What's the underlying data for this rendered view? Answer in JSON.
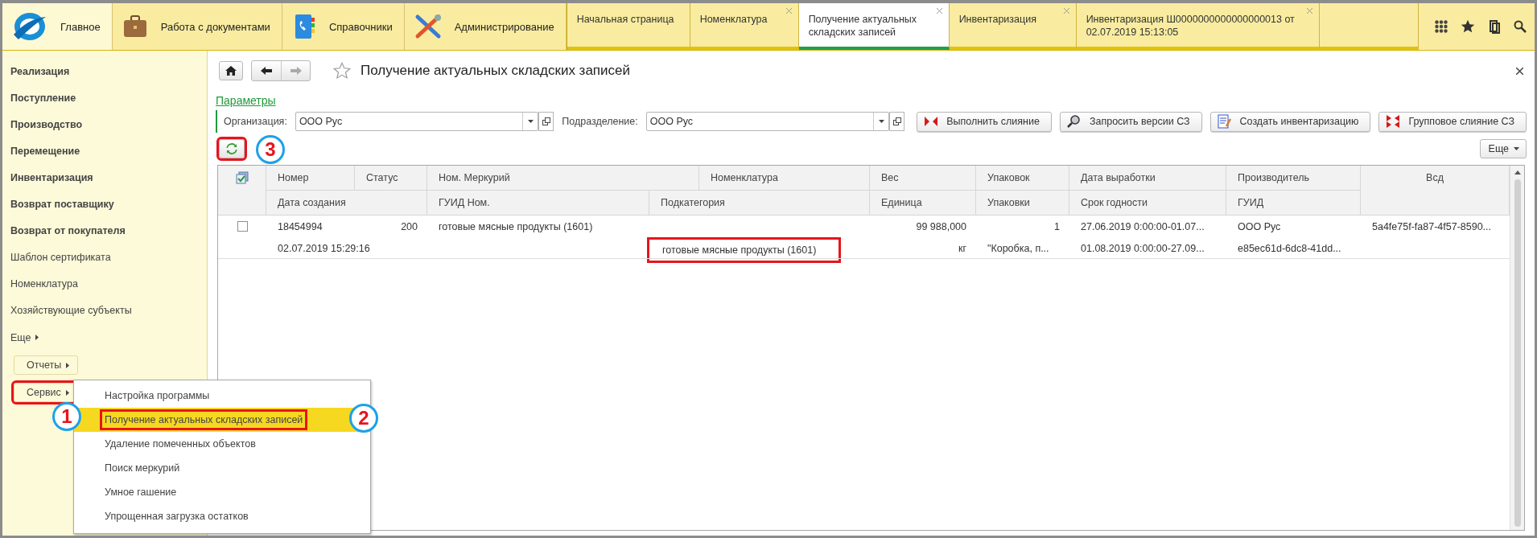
{
  "sections": [
    {
      "label": "Главное",
      "kind": "logo",
      "selected": true
    },
    {
      "label": "Работа с документами",
      "kind": "briefcase",
      "selected": false
    },
    {
      "label": "Справочники",
      "kind": "book",
      "selected": false
    },
    {
      "label": "Администрирование",
      "kind": "tools",
      "selected": false
    }
  ],
  "open_tabs": [
    {
      "label": "Начальная страница",
      "closable": false,
      "selected": false
    },
    {
      "label": "Номенклатура",
      "closable": true,
      "selected": false
    },
    {
      "label": "Получение актуальных складских записей",
      "closable": true,
      "selected": true
    },
    {
      "label": "Инвентаризация",
      "closable": true,
      "selected": false
    },
    {
      "label": "Инвентаризация Ш0000000000000000013 от 02.07.2019 15:13:05",
      "closable": true,
      "selected": false
    }
  ],
  "sidebar": {
    "items": [
      {
        "label": "Реализация",
        "bold": true
      },
      {
        "label": "Поступление",
        "bold": true
      },
      {
        "label": "Производство",
        "bold": true
      },
      {
        "label": "Перемещение",
        "bold": true
      },
      {
        "label": "Инвентаризация",
        "bold": true
      },
      {
        "label": "Возврат поставщику",
        "bold": true
      },
      {
        "label": "Возврат от покупателя",
        "bold": true
      },
      {
        "label": "Шаблон сертификата",
        "bold": false
      },
      {
        "label": "Номенклатура",
        "bold": false
      },
      {
        "label": "Хозяйствующие субъекты",
        "bold": false
      }
    ],
    "more": "Еще",
    "buttons": [
      {
        "label": "Отчеты",
        "highlighted": false
      },
      {
        "label": "Сервис",
        "highlighted": true,
        "callout": "1"
      }
    ]
  },
  "service_menu": [
    {
      "label": "Настройка программы",
      "selected": false,
      "highlighted": false
    },
    {
      "label": "Получение актуальных складских записей",
      "selected": true,
      "highlighted": true,
      "callout": "2"
    },
    {
      "label": "Удаление помеченных объектов",
      "selected": false,
      "highlighted": false
    },
    {
      "label": "Поиск меркурий",
      "selected": false,
      "highlighted": false
    },
    {
      "label": "Умное гашение",
      "selected": false,
      "highlighted": false
    },
    {
      "label": "Упрощенная загрузка остатков",
      "selected": false,
      "highlighted": false
    }
  ],
  "form": {
    "title": "Получение актуальных складских записей",
    "forward_disabled": true,
    "favorite": false,
    "parameters_link": "Параметры",
    "filters": [
      {
        "label": "Организация:",
        "value": "ООО Рус"
      },
      {
        "label": "Подразделение:",
        "value": "ООО Рус"
      }
    ],
    "actions": [
      {
        "label": "Выполнить слияние",
        "kind": "merge"
      },
      {
        "label": "Запросить версии СЗ",
        "kind": "query"
      },
      {
        "label": "Создать инвентаризацию",
        "kind": "inventory"
      },
      {
        "label": "Групповое слияние СЗ",
        "kind": "group"
      }
    ],
    "refresh": {
      "highlighted": true,
      "callout": "3"
    },
    "more_button": "Еще"
  },
  "table": {
    "header_top": [
      "Номер",
      "Статус",
      "Ном. Меркурий",
      "Номенклатура",
      "Вес",
      "Упаковок",
      "Дата выработки",
      "Производитель",
      "Всд"
    ],
    "header_bottom": [
      "Дата создания",
      "ГУИД Ном.",
      "Подкатегория",
      "Единица",
      "Упаковки",
      "Срок годности",
      "ГУИД"
    ],
    "rows": [
      {
        "checked": false,
        "line1": [
          {
            "text": "18454994",
            "highlighted": false
          },
          {
            "text": "200",
            "highlighted": false
          },
          {
            "text": "готовые мясные продукты (1601)",
            "highlighted": false
          },
          {
            "text": "99 988,000",
            "highlighted": false
          },
          {
            "text": "1",
            "highlighted": false
          },
          {
            "text": "27.06.2019 0:00:00-01.07...",
            "highlighted": false
          },
          {
            "text": "ООО Рус",
            "highlighted": false
          },
          {
            "text": "5a4fe75f-fa87-4f57-8590...",
            "highlighted": false
          }
        ],
        "line2": [
          {
            "text": "02.07.2019 15:29:16",
            "highlighted": false
          },
          {
            "text": "готовые мясные продукты (1601)",
            "highlighted": true
          },
          {
            "text": "кг",
            "highlighted": false
          },
          {
            "text": "\"Коробка, п...",
            "highlighted": false
          },
          {
            "text": "01.08.2019 0:00:00-27.09...",
            "highlighted": false
          },
          {
            "text": "e85ec61d-6dc8-41dd...",
            "highlighted": false
          }
        ]
      }
    ]
  }
}
